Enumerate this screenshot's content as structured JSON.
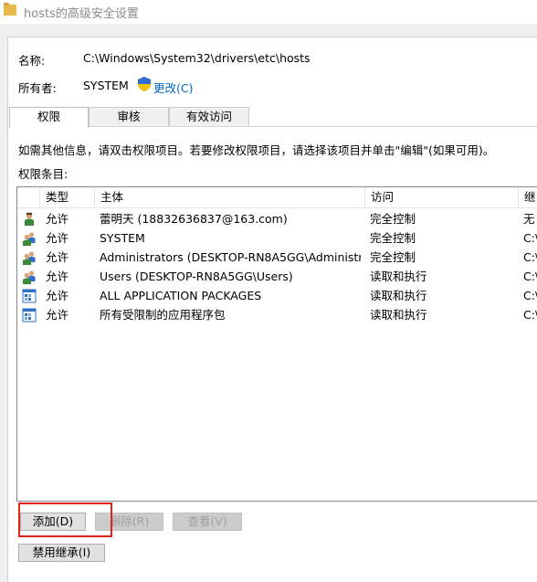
{
  "window": {
    "title": "hosts的高级安全设置"
  },
  "name_row": {
    "label": "名称:",
    "value": "C:\\Windows\\System32\\drivers\\etc\\hosts"
  },
  "owner_row": {
    "label": "所有者:",
    "value": "SYSTEM",
    "change_link": "更改(C)"
  },
  "tabs": [
    {
      "label": "权限",
      "active": true
    },
    {
      "label": "审核",
      "active": false
    },
    {
      "label": "有效访问",
      "active": false
    }
  ],
  "info_text": "如需其他信息，请双击权限项目。若要修改权限项目，请选择该项目并单击\"编辑\"(如果可用)。",
  "entries_label": "权限条目:",
  "columns": [
    "类型",
    "主体",
    "访问",
    "继"
  ],
  "rows": [
    {
      "icon": "user-icon",
      "type": "允许",
      "principal": "蕾明天 (18832636837@163.com)",
      "access": "完全控制",
      "inherit": "无"
    },
    {
      "icon": "group-icon",
      "type": "允许",
      "principal": "SYSTEM",
      "access": "完全控制",
      "inherit": "C:\\"
    },
    {
      "icon": "group-icon",
      "type": "允许",
      "principal": "Administrators (DESKTOP-RN8A5GG\\Administr...",
      "access": "完全控制",
      "inherit": "C:\\"
    },
    {
      "icon": "group-icon",
      "type": "允许",
      "principal": "Users (DESKTOP-RN8A5GG\\Users)",
      "access": "读取和执行",
      "inherit": "C:\\"
    },
    {
      "icon": "package-icon",
      "type": "允许",
      "principal": "ALL APPLICATION PACKAGES",
      "access": "读取和执行",
      "inherit": "C:\\"
    },
    {
      "icon": "package-icon",
      "type": "允许",
      "principal": "所有受限制的应用程序包",
      "access": "读取和执行",
      "inherit": "C:\\"
    }
  ],
  "buttons": {
    "add": "添加(D)",
    "remove": "删除(R)",
    "view": "查看(V)",
    "disable_inheritance": "禁用继承(I)"
  },
  "colors": {
    "link": "#0066cc",
    "highlight": "#e0241c"
  }
}
